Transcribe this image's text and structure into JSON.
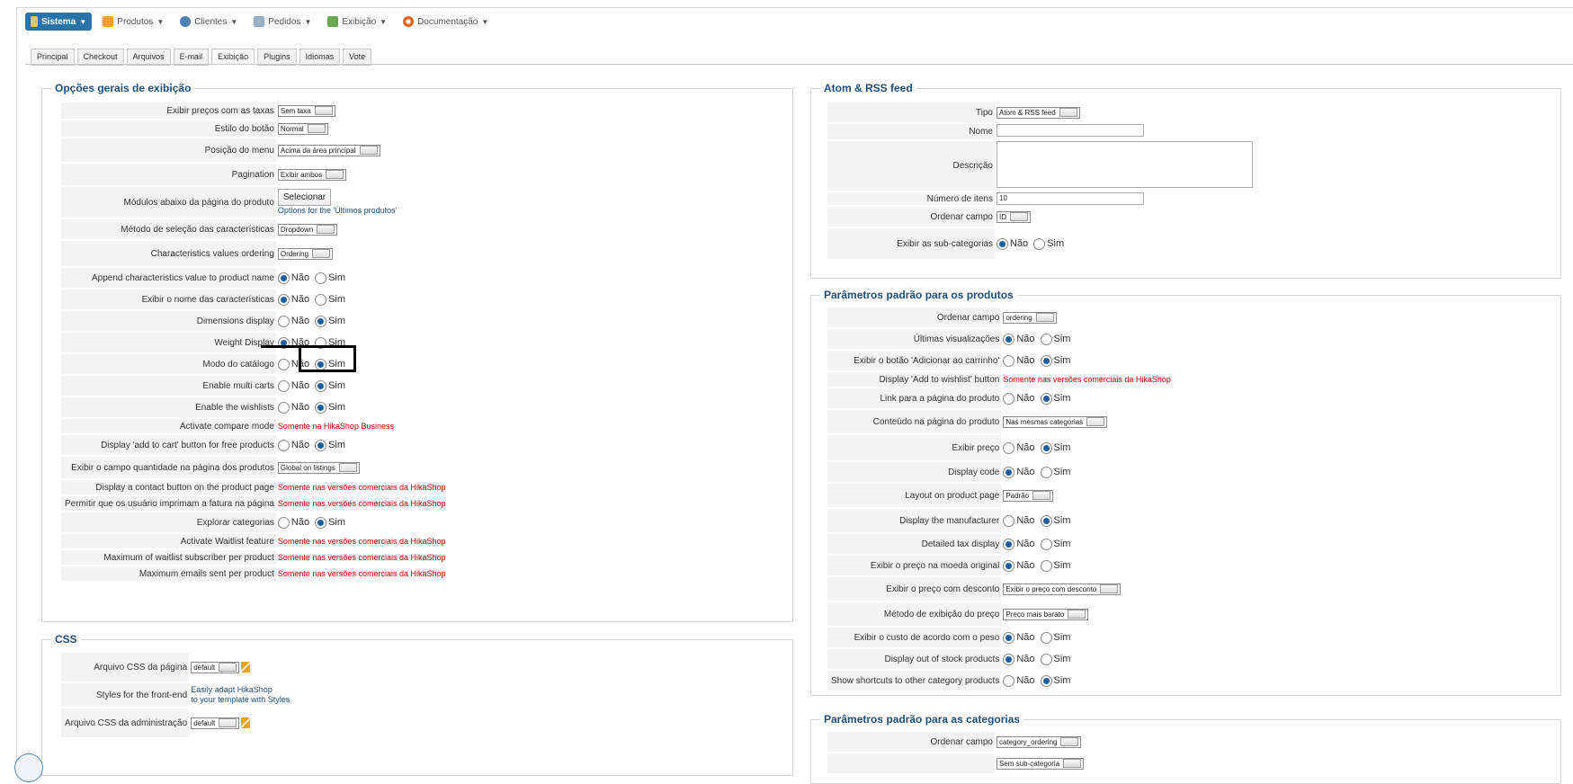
{
  "menu": {
    "items": [
      {
        "label": "Sistema",
        "icon": "wrench-icon"
      },
      {
        "label": "Produtos",
        "icon": "box-icon"
      },
      {
        "label": "Clientes",
        "icon": "users-icon"
      },
      {
        "label": "Pedidos",
        "icon": "cart-icon"
      },
      {
        "label": "Exibição",
        "icon": "display-icon"
      },
      {
        "label": "Documentação",
        "icon": "lifebuoy-icon"
      }
    ]
  },
  "tabs": [
    "Principal",
    "Checkout",
    "Arquivos",
    "E-mail",
    "Exibição",
    "Plugins",
    "Idiomas",
    "Vote"
  ],
  "active_tab": "Exibição",
  "radio_labels": {
    "no": "Não",
    "yes": "Sim"
  },
  "general": {
    "legend": "Opções gerais de exibição",
    "rows": [
      {
        "label": "Exibir preços com as taxas",
        "type": "select",
        "value": "Sem taxa"
      },
      {
        "label": "Estilo do botão",
        "type": "select",
        "value": "Normal"
      },
      {
        "label": "Posição do menu",
        "type": "select",
        "value": "Acima da área principal"
      },
      {
        "label": "Pagination",
        "type": "select",
        "value": "Exibir ambos"
      },
      {
        "label": "Módulos abaixo da página do produto",
        "type": "button",
        "value": "Selecionar",
        "note": "Options for the 'Últimos produtos'"
      },
      {
        "label": "Método de seleção das características",
        "type": "select",
        "value": "Dropdown"
      },
      {
        "label": "Characteristics values ordering",
        "type": "select",
        "value": "Ordering"
      },
      {
        "label": "Append characteristics value to product name",
        "type": "radio",
        "value": "no"
      },
      {
        "label": "Exibir o nome das características",
        "type": "radio",
        "value": "no"
      },
      {
        "label": "Dimensions display",
        "type": "radio",
        "value": "yes"
      },
      {
        "label": "Weight Display",
        "type": "radio",
        "value": "no"
      },
      {
        "label": "Modo do catálogo",
        "type": "radio",
        "value": "yes"
      },
      {
        "label": "Enable multi carts",
        "type": "radio",
        "value": "yes"
      },
      {
        "label": "Enable the wishlists",
        "type": "radio",
        "value": "yes"
      },
      {
        "label": "Activate compare mode",
        "type": "red",
        "value": "Somente na HikaShop Business"
      },
      {
        "label": "Display 'add to cart' button for free products",
        "type": "radio",
        "value": "yes"
      },
      {
        "label": "Exibir o campo quantidade na página dos produtos",
        "type": "select",
        "value": "Global on listings"
      },
      {
        "label": "Display a contact button on the product page",
        "type": "red",
        "value": "Somente nas versões comerciais da HikaShop"
      },
      {
        "label": "Permitir que os usuário imprimam a fatura na página",
        "type": "red",
        "value": "Somente nas versões comerciais da HikaShop"
      },
      {
        "label": "Explorar categorias",
        "type": "radio",
        "value": "yes"
      },
      {
        "label": "Activate Waitlist feature",
        "type": "red",
        "value": "Somente nas versões comerciais da HikaShop"
      },
      {
        "label": "Maximum of waitlist subscriber per product",
        "type": "red",
        "value": "Somente nas versões comerciais da HikaShop"
      },
      {
        "label": "Maximum emails sent per product",
        "type": "red",
        "value": "Somente nas versões comerciais da HikaShop"
      }
    ]
  },
  "css": {
    "legend": "CSS",
    "rows": [
      {
        "label": "Arquivo CSS da página",
        "type": "select",
        "value": "default"
      },
      {
        "label": "Styles for the front-end",
        "type": "link",
        "value": "Easily adapt HikaShop",
        "value2": "to your template with Styles"
      },
      {
        "label": "Arquivo CSS da administração",
        "type": "select",
        "value": "default"
      }
    ]
  },
  "atom": {
    "legend": "Atom & RSS feed",
    "rows": [
      {
        "label": "Tipo",
        "type": "select",
        "value": "Atom & RSS feed"
      },
      {
        "label": "Nome",
        "type": "text",
        "value": ""
      },
      {
        "label": "Descrição",
        "type": "textarea",
        "value": ""
      },
      {
        "label": "Número de itens",
        "type": "text",
        "value": "10"
      },
      {
        "label": "Ordenar campo",
        "type": "select",
        "value": "ID"
      },
      {
        "label": "Exibir as sub-categorias",
        "type": "radio",
        "value": "no"
      }
    ]
  },
  "products": {
    "legend": "Parâmetros padrão para os produtos",
    "rows": [
      {
        "label": "Ordenar campo",
        "type": "select",
        "value": "ordering"
      },
      {
        "label": "Últimas visualizações",
        "type": "radio",
        "value": "no"
      },
      {
        "label": "Exibir o botão 'Adicionar ao carrinho'",
        "type": "radio",
        "value": "yes"
      },
      {
        "label": "Display 'Add to wishlist' button",
        "type": "red",
        "value": "Somente nas versões comerciais da HikaShop"
      },
      {
        "label": "Link para a página do produto",
        "type": "radio",
        "value": "yes"
      },
      {
        "label": "Conteúdo na página do produto",
        "type": "select",
        "value": "Nas mesmas categorias"
      },
      {
        "label": "Exibir preço",
        "type": "radio",
        "value": "yes"
      },
      {
        "label": "Display code",
        "type": "radio",
        "value": "no"
      },
      {
        "label": "Layout on product page",
        "type": "select",
        "value": "Padrão"
      },
      {
        "label": "Display the manufacturer",
        "type": "radio",
        "value": "yes"
      },
      {
        "label": "Detailed tax display",
        "type": "radio",
        "value": "no"
      },
      {
        "label": "Exibir o preço na moeda original",
        "type": "radio",
        "value": "no"
      },
      {
        "label": "Exibir o preço com desconto",
        "type": "select",
        "value": "Exibir o preço com desconto"
      },
      {
        "label": "Método de exibição do preço",
        "type": "select",
        "value": "Preço mais barato"
      },
      {
        "label": "Exibir o custo de acordo com o peso",
        "type": "radio",
        "value": "no"
      },
      {
        "label": "Display out of stock products",
        "type": "radio",
        "value": "no"
      },
      {
        "label": "Show shortcuts to other category products",
        "type": "radio",
        "value": "yes"
      }
    ]
  },
  "categories": {
    "legend": "Parâmetros padrão para as categorias",
    "rows": [
      {
        "label": "Ordenar campo",
        "type": "select",
        "value": "category_ordering"
      },
      {
        "label": "",
        "type": "select",
        "value": "Sem sub-categoria"
      }
    ]
  }
}
